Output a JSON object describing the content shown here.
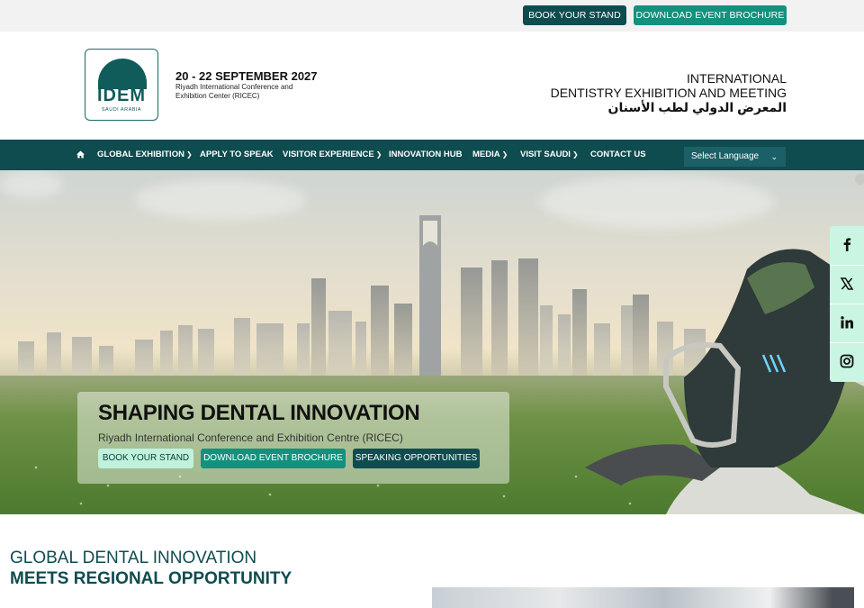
{
  "topbar": {
    "book_stand": "BOOK YOUR STAND",
    "download_brochure": "DOWNLOAD EVENT BROCHURE"
  },
  "header": {
    "logo_word": "IDEM",
    "logo_sub": "SAUDI ARABIA",
    "date": "20 - 22 SEPTEMBER 2027",
    "venue": "Riyadh International Conference and Exhibition Center (RICEC)",
    "right_line1": "INTERNATIONAL",
    "right_line2": "DENTISTRY EXHIBITION AND MEETING",
    "right_line3": "المعرض الدولي لطب الأسنان"
  },
  "nav": {
    "items": [
      {
        "label": "GLOBAL EXHIBITION",
        "dropdown": true
      },
      {
        "label": "APPLY TO SPEAK",
        "dropdown": false
      },
      {
        "label": "VISITOR EXPERIENCE",
        "dropdown": true
      },
      {
        "label": "INNOVATION HUB",
        "dropdown": false
      },
      {
        "label": "MEDIA",
        "dropdown": true
      },
      {
        "label": "VISIT SAUDI",
        "dropdown": true
      },
      {
        "label": "CONTACT US",
        "dropdown": false
      }
    ],
    "language": "Select Language"
  },
  "hero": {
    "title": "SHAPING DENTAL INNOVATION",
    "subtitle": "Riyadh International Conference and Exhibition Centre (RICEC)",
    "buttons": [
      "BOOK YOUR STAND",
      "DOWNLOAD EVENT BROCHURE",
      "SPEAKING OPPORTUNITIES"
    ]
  },
  "social": [
    "facebook-icon",
    "x-icon",
    "linkedin-icon",
    "instagram-icon"
  ],
  "section": {
    "line1": "GLOBAL DENTAL INNOVATION",
    "line2": "MEETS REGIONAL OPPORTUNITY"
  },
  "colors": {
    "primary": "#0f4c4f",
    "accent": "#13917d",
    "mint": "#c9f5e2"
  }
}
